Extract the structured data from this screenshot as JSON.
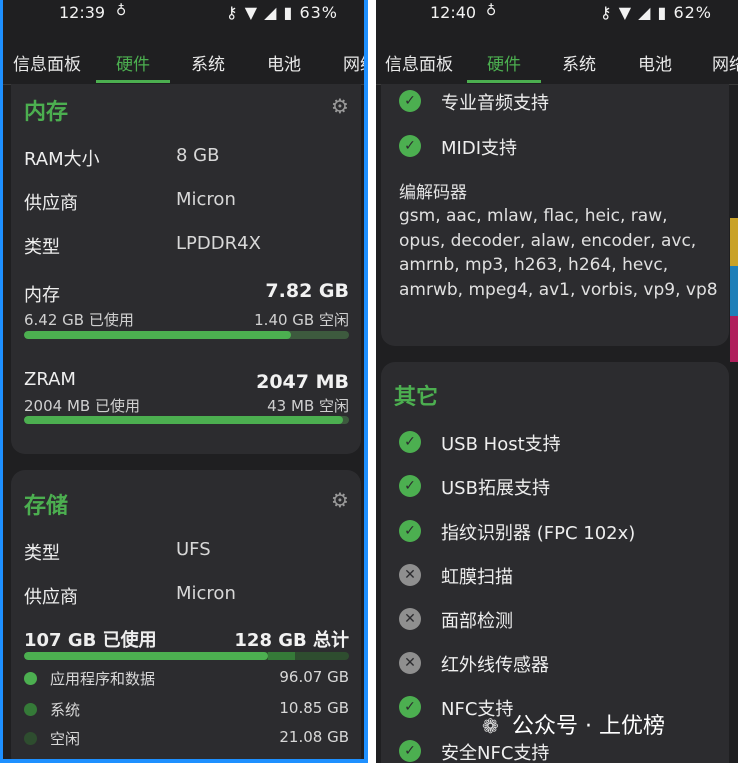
{
  "left": {
    "status": {
      "time": "12:39",
      "notif_icon": "cat-notification-icon",
      "battery": "63%"
    },
    "tabs": [
      "信息面板",
      "硬件",
      "系统",
      "电池",
      "网络"
    ],
    "active_tab": 1,
    "memory_card": {
      "title": "内存",
      "rows": [
        {
          "label": "RAM大小",
          "value": "8 GB"
        },
        {
          "label": "供应商",
          "value": "Micron"
        },
        {
          "label": "类型",
          "value": "LPDDR4X"
        }
      ],
      "ram": {
        "title": "内存",
        "total": "7.82 GB",
        "used": "6.42 GB 已使用",
        "free": "1.40 GB 空闲",
        "used_fraction": 0.82
      },
      "zram": {
        "title": "ZRAM",
        "total": "2047 MB",
        "used": "2004 MB 已使用",
        "free": "43 MB 空闲",
        "used_fraction": 0.98
      }
    },
    "storage_card": {
      "title": "存储",
      "rows": [
        {
          "label": "类型",
          "value": "UFS"
        },
        {
          "label": "供应商",
          "value": "Micron"
        }
      ],
      "used": "107 GB 已使用",
      "total": "128 GB 总计",
      "apps_fraction": 0.75,
      "system_fraction": 0.085,
      "legend": [
        {
          "label": "应用程序和数据",
          "value": "96.07 GB",
          "color": "#4caf50"
        },
        {
          "label": "系统",
          "value": "10.85 GB",
          "color": "#357a38"
        },
        {
          "label": "空闲",
          "value": "21.08 GB",
          "color": "#2e4d2f"
        }
      ]
    }
  },
  "right": {
    "status": {
      "time": "12:40",
      "notif_icon": "cat-notification-icon",
      "battery": "62%"
    },
    "tabs": [
      "信息面板",
      "硬件",
      "系统",
      "电池",
      "网络"
    ],
    "active_tab": 1,
    "audio_card": {
      "features": [
        {
          "label": "专业音频支持",
          "ok": true
        },
        {
          "label": "MIDI支持",
          "ok": true
        }
      ],
      "codec_title": "编解码器",
      "codecs": "gsm, aac, mlaw, flac, heic, raw, opus, decoder, alaw, encoder, avc, amrnb, mp3, h263, h264, hevc, amrwb, mpeg4, av1, vorbis, vp9, vp8"
    },
    "other_card": {
      "title": "其它",
      "features": [
        {
          "label": "USB Host支持",
          "ok": true
        },
        {
          "label": "USB拓展支持",
          "ok": true
        },
        {
          "label": "指纹识别器 (FPC 102x)",
          "ok": true
        },
        {
          "label": "虹膜扫描",
          "ok": false
        },
        {
          "label": "面部检测",
          "ok": false
        },
        {
          "label": "红外线传感器",
          "ok": false
        },
        {
          "label": "NFC支持",
          "ok": true
        },
        {
          "label": "安全NFC支持",
          "ok": true
        }
      ]
    }
  },
  "watermark": "公众号 · 上优榜",
  "colors": {
    "accent": "#4caf50",
    "panel_bg": "#1f1f21",
    "card_bg": "#2c2c2f",
    "frame": "#1e90ff"
  }
}
